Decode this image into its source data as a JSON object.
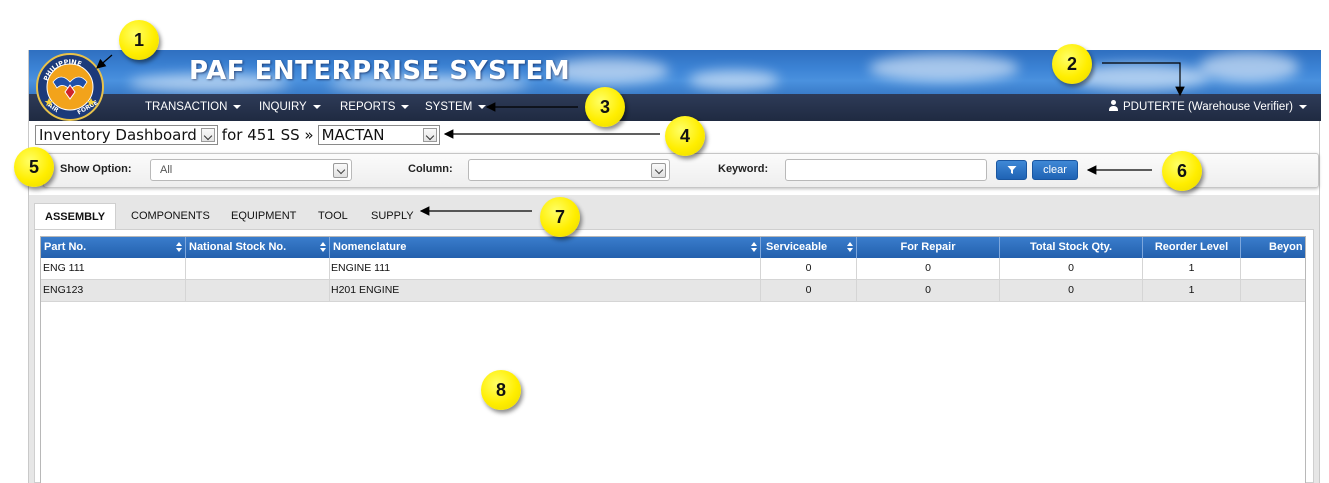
{
  "app": {
    "title": "PAF ENTERPRISE SYSTEM",
    "logo_text_top": "PHILIPPINE",
    "logo_text_bottom_left": "AIR",
    "logo_text_bottom_right": "FORCE"
  },
  "nav": {
    "items": [
      {
        "label": "TRANSACTION"
      },
      {
        "label": "INQUIRY"
      },
      {
        "label": "REPORTS"
      },
      {
        "label": "SYSTEM"
      }
    ],
    "user": "PDUTERTE (Warehouse Verifier)"
  },
  "selector": {
    "dashboard": "Inventory Dashboard",
    "for_text": "for 451 SS »",
    "location": "MACTAN"
  },
  "filters": {
    "show_option_label": "Show Option:",
    "show_option_value": "All",
    "column_label": "Column:",
    "column_value": "",
    "keyword_label": "Keyword:",
    "keyword_value": "",
    "clear_label": "clear"
  },
  "tabs": [
    {
      "label": "ASSEMBLY",
      "active": true
    },
    {
      "label": "COMPONENTS"
    },
    {
      "label": "EQUIPMENT"
    },
    {
      "label": "TOOL"
    },
    {
      "label": "SUPPLY"
    }
  ],
  "grid": {
    "columns": [
      "Part No.",
      "National Stock No.",
      "Nomenclature",
      "Serviceable",
      "For Repair",
      "Total Stock Qty.",
      "Reorder Level",
      "Beyon"
    ],
    "rows": [
      [
        "ENG 111",
        "",
        "ENGINE 111",
        "0",
        "0",
        "0",
        "1",
        ""
      ],
      [
        "ENG123",
        "",
        "H201 ENGINE",
        "0",
        "0",
        "0",
        "1",
        ""
      ]
    ]
  },
  "callouts": [
    "1",
    "2",
    "3",
    "4",
    "5",
    "6",
    "7",
    "8"
  ],
  "colors": {
    "banner": "#3b82d4",
    "navbar": "#26324b",
    "grid_header": "#2e6dbd",
    "callout": "#ffee00"
  }
}
